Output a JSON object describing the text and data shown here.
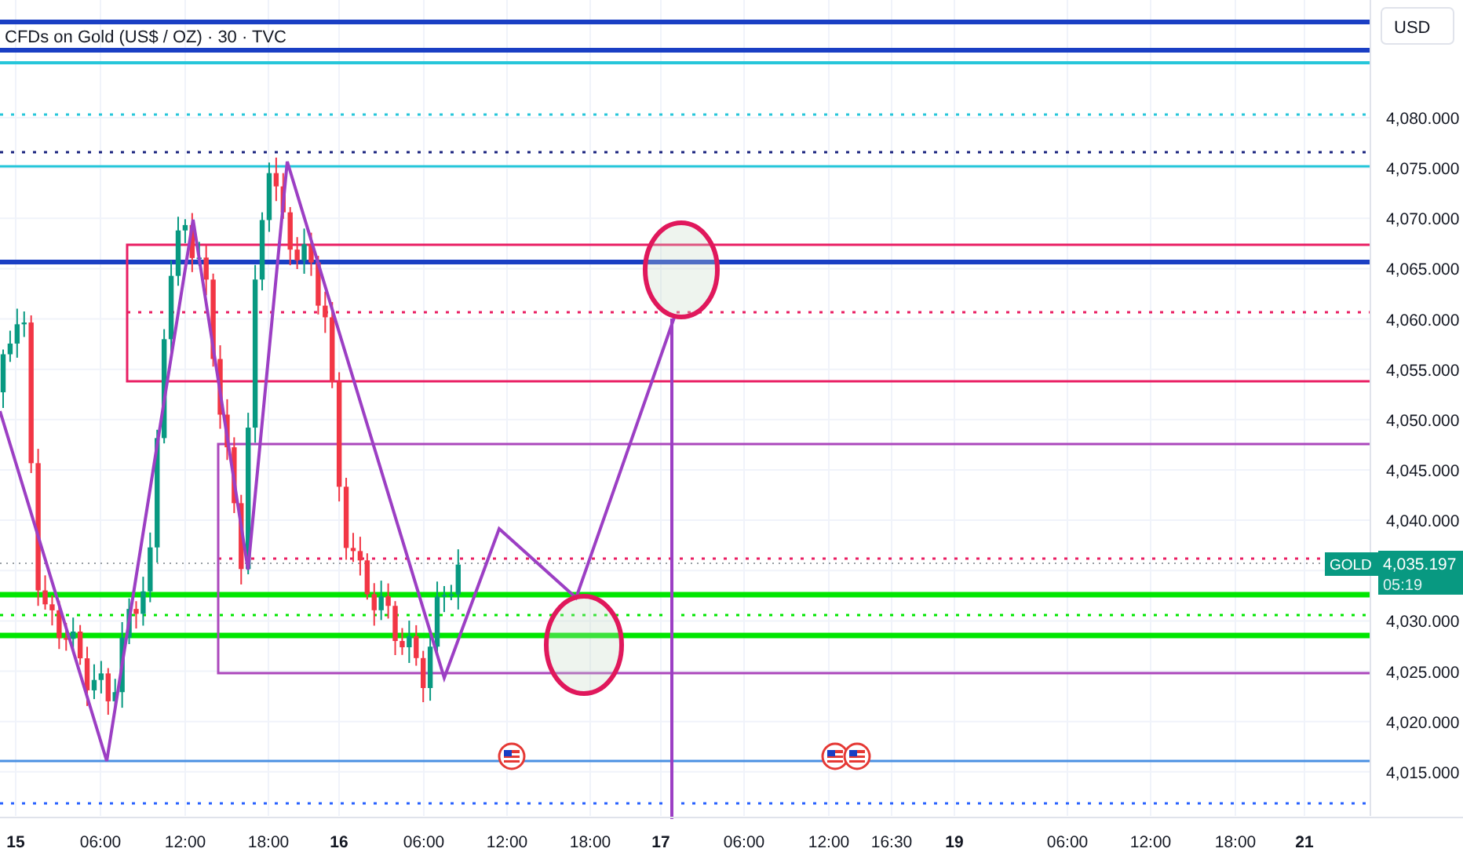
{
  "chart_title": "CFDs on Gold (US$ / OZ) · 30 · TVC",
  "currency_button": "USD",
  "price_axis": {
    "ticks": [
      "4,080.000",
      "4,075.000",
      "4,070.000",
      "4,065.000",
      "4,060.000",
      "4,055.000",
      "4,050.000",
      "4,045.000",
      "4,040.000",
      "4,030.000",
      "4,025.000",
      "4,020.000",
      "4,015.000"
    ]
  },
  "last_price": {
    "symbol": "GOLD",
    "price": "4,035.197",
    "countdown": "05:19"
  },
  "time_axis": {
    "labels": [
      {
        "text": "15",
        "kind": "day"
      },
      {
        "text": "06:00",
        "kind": "time"
      },
      {
        "text": "12:00",
        "kind": "time"
      },
      {
        "text": "18:00",
        "kind": "time"
      },
      {
        "text": "16",
        "kind": "day"
      },
      {
        "text": "06:00",
        "kind": "time"
      },
      {
        "text": "12:00",
        "kind": "time"
      },
      {
        "text": "18:00",
        "kind": "time"
      },
      {
        "text": "17",
        "kind": "day"
      },
      {
        "text": "06:00",
        "kind": "time"
      },
      {
        "text": "12:00",
        "kind": "time"
      },
      {
        "text": "16:30",
        "kind": "time"
      },
      {
        "text": "19",
        "kind": "day"
      },
      {
        "text": "06:00",
        "kind": "time"
      },
      {
        "text": "12:00",
        "kind": "time"
      },
      {
        "text": "18:00",
        "kind": "time"
      },
      {
        "text": "21",
        "kind": "day"
      }
    ]
  }
}
